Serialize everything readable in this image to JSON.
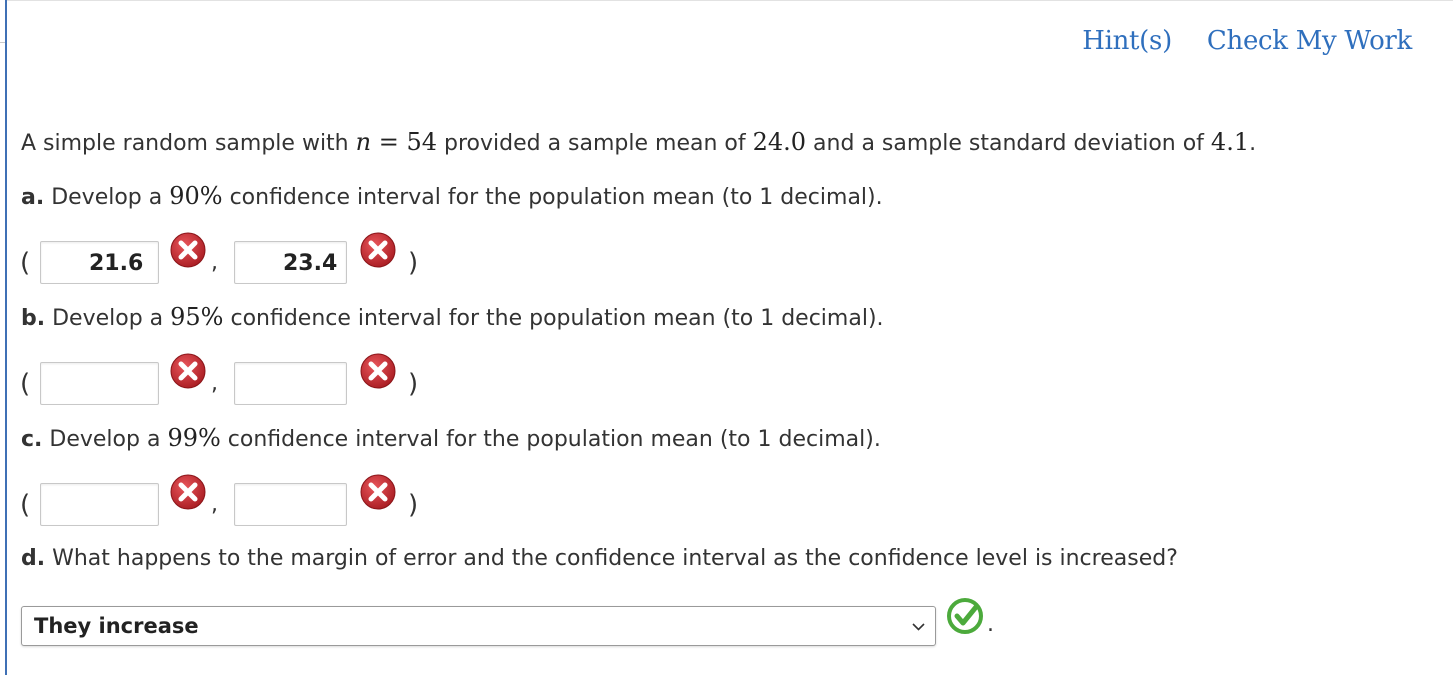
{
  "header": {
    "hints_label": "Hint(s)",
    "check_label": "Check My Work"
  },
  "intro": {
    "text_1": "A simple random sample with ",
    "n_var": "n",
    "eq": " = ",
    "n_val": "54",
    "text_2": " provided a sample mean of ",
    "mean": "24.0",
    "text_3": " and a sample standard deviation of ",
    "sd": "4.1",
    "text_4": "."
  },
  "parts": [
    {
      "label": "a.",
      "pre": " Develop a ",
      "level": "90%",
      "post": " confidence interval for the population mean (to 1 decimal).",
      "lower": "21.6",
      "upper": "23.4",
      "lower_status": "incorrect",
      "upper_status": "incorrect"
    },
    {
      "label": "b.",
      "pre": " Develop a ",
      "level": "95%",
      "post": " confidence interval for the population mean (to 1 decimal).",
      "lower": "",
      "upper": "",
      "lower_status": "incorrect",
      "upper_status": "incorrect"
    },
    {
      "label": "c.",
      "pre": " Develop a ",
      "level": "99%",
      "post": " confidence interval for the population mean (to 1 decimal).",
      "lower": "",
      "upper": "",
      "lower_status": "incorrect",
      "upper_status": "incorrect"
    }
  ],
  "part_d": {
    "label": "d.",
    "text": " What happens to the margin of error and the confidence interval as the confidence level is increased?",
    "selected": "They increase",
    "status": "correct",
    "suffix": "."
  },
  "punct": {
    "open": "(",
    "close": ")",
    "comma": ","
  },
  "colors": {
    "link": "#2f6fbd",
    "incorrect": "#c0282d",
    "correct": "#4caa3c",
    "rule": "#3f70b5"
  },
  "icons": {
    "incorrect": "x-circle-icon",
    "correct": "check-circle-icon",
    "dropdown": "chevron-down-icon"
  }
}
